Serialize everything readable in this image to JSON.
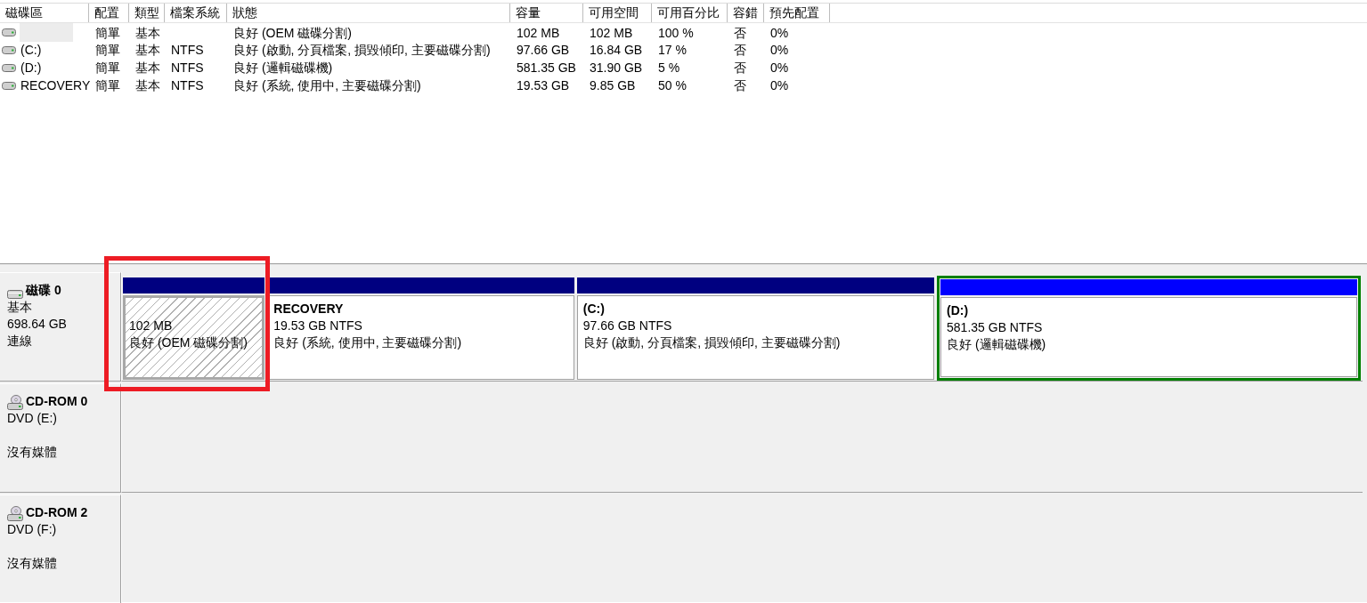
{
  "volume_list": {
    "columns": [
      "磁碟區",
      "配置",
      "類型",
      "檔案系統",
      "狀態",
      "容量",
      "可用空間",
      "可用百分比",
      "容錯",
      "預先配置"
    ],
    "rows": [
      {
        "selected": true,
        "layout": "簡單",
        "type": "基本",
        "status": "良好 (OEM 磁碟分割)",
        "capacity": "102 MB",
        "free_space": "102 MB",
        "percent_free": "100 %",
        "fault_tolerance": "否",
        "overhead": "0%"
      },
      {
        "selected": false,
        "volume": "(C:)",
        "layout": "簡單",
        "type": "基本",
        "file_system": "NTFS",
        "status": "良好 (啟動, 分頁檔案, 損毀傾印, 主要磁碟分割)",
        "capacity": "97.66 GB",
        "free_space": "16.84 GB",
        "percent_free": "17 %",
        "fault_tolerance": "否",
        "overhead": "0%"
      },
      {
        "selected": false,
        "volume": "(D:)",
        "layout": "簡單",
        "type": "基本",
        "file_system": "NTFS",
        "status": "良好 (邏輯磁碟機)",
        "capacity": "581.35 GB",
        "free_space": "31.90 GB",
        "percent_free": "5 %",
        "fault_tolerance": "否",
        "overhead": "0%"
      },
      {
        "selected": false,
        "volume": "RECOVERY",
        "layout": "簡單",
        "type": "基本",
        "file_system": "NTFS",
        "status": "良好 (系統, 使用中, 主要磁碟分割)",
        "capacity": "19.53 GB",
        "free_space": "9.85 GB",
        "percent_free": "50 %",
        "fault_tolerance": "否",
        "overhead": "0%"
      }
    ]
  },
  "disk_map": {
    "disks": [
      {
        "kind": "disk",
        "name": "磁碟 0",
        "type": "基本",
        "size": "698.64 GB",
        "status": "連線",
        "partitions": [
          {
            "kind": "primary",
            "selected": true,
            "annotated": true,
            "size": "102 MB",
            "status": "良好 (OEM 磁碟分割)"
          },
          {
            "kind": "primary",
            "selected": false,
            "annotated": false,
            "label": "RECOVERY",
            "size": "19.53 GB NTFS",
            "status": "良好 (系統, 使用中, 主要磁碟分割)"
          },
          {
            "kind": "primary",
            "selected": false,
            "annotated": false,
            "label": "(C:)",
            "size": "97.66 GB NTFS",
            "status": "良好 (啟動, 分頁檔案, 損毀傾印, 主要磁碟分割)"
          },
          {
            "kind": "logical",
            "selected": false,
            "annotated": false,
            "label": "(D:)",
            "size": "581.35 GB NTFS",
            "status": "良好 (邏輯磁碟機)"
          }
        ]
      },
      {
        "kind": "cdrom",
        "name": "CD-ROM 0",
        "type": "DVD (E:)",
        "status": "沒有媒體"
      },
      {
        "kind": "cdrom",
        "name": "CD-ROM 2",
        "type": "DVD (F:)",
        "status": "沒有媒體"
      }
    ]
  }
}
